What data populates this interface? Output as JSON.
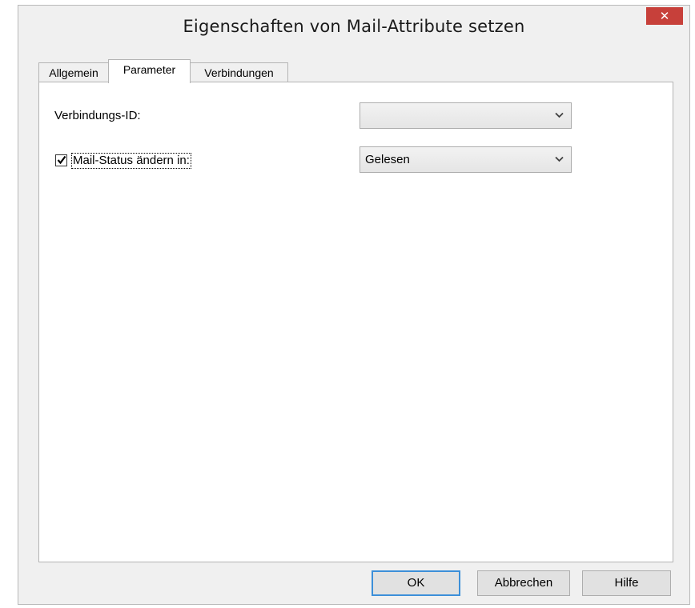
{
  "window": {
    "title": "Eigenschaften von Mail-Attribute setzen",
    "close_glyph": "✕"
  },
  "tabs": [
    {
      "label": "Allgemein",
      "active": false
    },
    {
      "label": "Parameter",
      "active": true
    },
    {
      "label": "Verbindungen",
      "active": false
    }
  ],
  "parameter": {
    "verbindungs_id_label": "Verbindungs-ID:",
    "verbindungs_id_value": "",
    "mail_status_label": "Mail-Status ändern in:",
    "mail_status_checked": true,
    "mail_status_value": "Gelesen"
  },
  "buttons": {
    "ok": "OK",
    "cancel": "Abbrechen",
    "help": "Hilfe"
  },
  "icons": {
    "close": "close-icon",
    "dropdown": "chevron-down-icon",
    "check": "checkmark-icon"
  },
  "colors": {
    "close_bg": "#c7403a",
    "default_button_border": "#3c8fd9"
  }
}
